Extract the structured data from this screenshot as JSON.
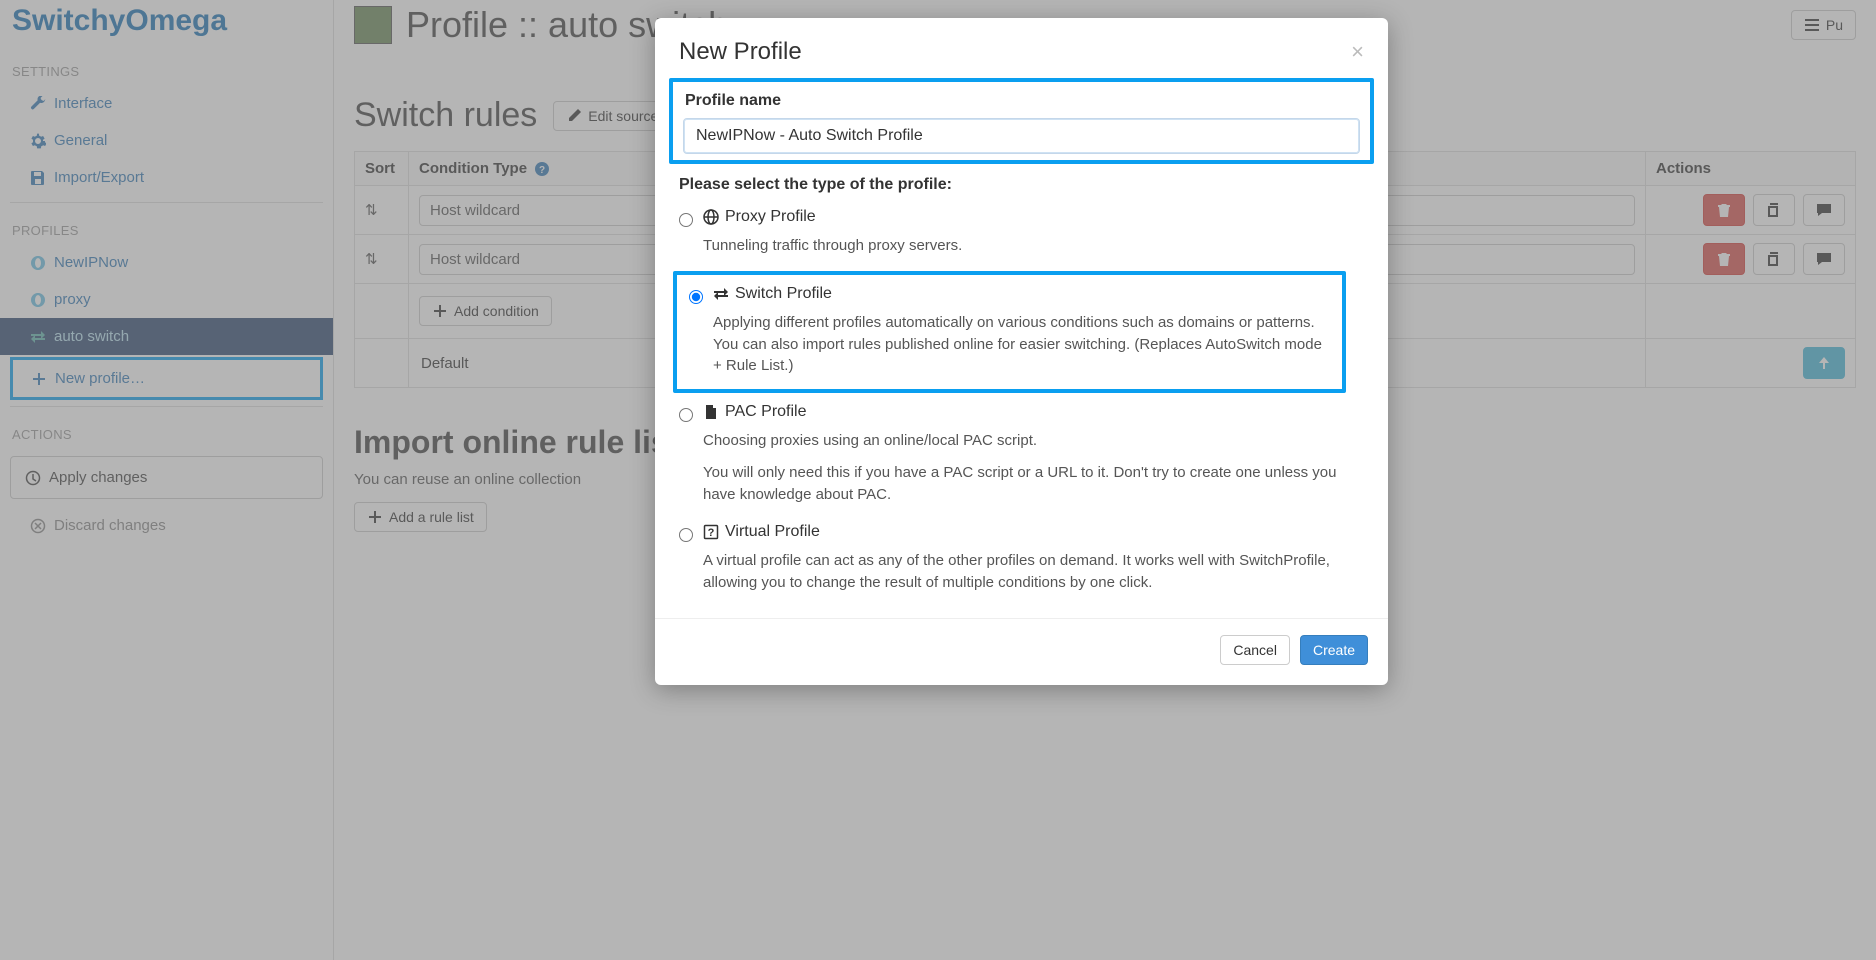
{
  "brand": "SwitchyOmega",
  "sidebar": {
    "settings_label": "SETTINGS",
    "interface": "Interface",
    "general": "General",
    "import_export": "Import/Export",
    "profiles_label": "PROFILES",
    "profiles": [
      "NewIPNow",
      "proxy",
      "auto switch"
    ],
    "new_profile": "New profile…",
    "actions_label": "ACTIONS",
    "apply": "Apply changes",
    "discard": "Discard changes"
  },
  "page": {
    "title": "Profile :: auto switch",
    "publish_btn": "Pu"
  },
  "rules": {
    "heading": "Switch rules",
    "edit_source": "Edit source c",
    "columns": {
      "sort": "Sort",
      "type": "Condition Type",
      "actions": "Actions"
    },
    "rows": [
      {
        "type": "Host wildcard"
      },
      {
        "type": "Host wildcard"
      }
    ],
    "add_condition": "Add condition",
    "default": "Default"
  },
  "import": {
    "heading": "Import online rule lists",
    "subtext": "You can reuse an online collection",
    "add_rule": "Add a rule list"
  },
  "modal": {
    "title": "New Profile",
    "name_label": "Profile name",
    "name_value": "NewIPNow - Auto Switch Profile",
    "type_prompt": "Please select the type of the profile:",
    "types": {
      "proxy": {
        "label": "Proxy Profile",
        "desc": "Tunneling traffic through proxy servers."
      },
      "switch": {
        "label": "Switch Profile",
        "desc": "Applying different profiles automatically on various conditions such as domains or patterns. You can also import rules published online for easier switching. (Replaces AutoSwitch mode + Rule List.)"
      },
      "pac": {
        "label": "PAC Profile",
        "desc1": "Choosing proxies using an online/local PAC script.",
        "desc2": "You will only need this if you have a PAC script or a URL to it. Don't try to create one unless you have knowledge about PAC."
      },
      "virtual": {
        "label": "Virtual Profile",
        "desc": "A virtual profile can act as any of the other profiles on demand. It works well with SwitchProfile, allowing you to change the result of multiple conditions by one click."
      }
    },
    "cancel": "Cancel",
    "create": "Create"
  }
}
